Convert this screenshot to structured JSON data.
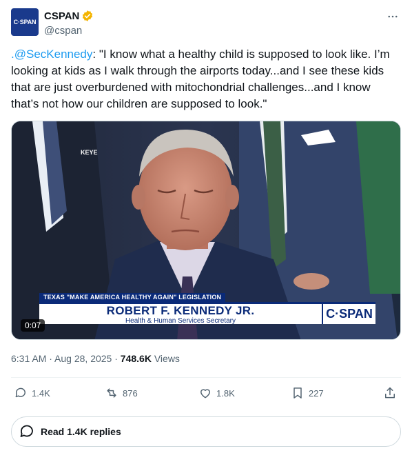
{
  "author": {
    "display_name": "CSPAN",
    "handle": "@cspan",
    "avatar_text": "C·SPAN",
    "verified": true,
    "verified_color": "#f4b400"
  },
  "tweet": {
    "mention": ".@SecKennedy",
    "body": ": \"I know what a healthy child is supposed to look like. I’m looking at kids as I walk through the airports today...and I see these kids that are just overburdened with mitochondrial challenges...and I know that’s not how our children are supposed to look.\""
  },
  "media": {
    "station_tag": "KEYE",
    "lower_third_topic": "TEXAS \"MAKE AMERICA HEALTHY AGAIN\" LEGISLATION",
    "lower_third_name": "ROBERT F. KENNEDY JR.",
    "lower_third_title": "Health & Human Services Secretary",
    "lower_third_logo": "C·SPAN",
    "duration": "0:07"
  },
  "meta": {
    "time": "6:31 AM",
    "separator": " · ",
    "date": "Aug 28, 2025",
    "views_count": "748.6K",
    "views_label": " Views"
  },
  "actions": {
    "replies": "1.4K",
    "reposts": "876",
    "likes": "1.8K",
    "bookmarks": "227"
  },
  "read_replies_label": "Read 1.4K replies",
  "colors": {
    "accent": "#1d9bf0",
    "cspan_blue": "#0a2a78",
    "muted_text": "#536471"
  }
}
